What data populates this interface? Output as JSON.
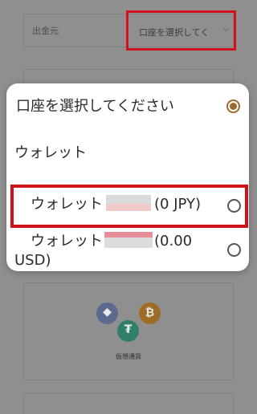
{
  "form": {
    "source_label": "出金元",
    "source_select_value": "口座を選択してく"
  },
  "crypto": {
    "label": "仮想通貨",
    "icons": [
      "ethereum-icon",
      "bitcoin-icon",
      "tether-icon"
    ],
    "glyphs": {
      "eth": "◆",
      "btc": "₿",
      "usdt": "₮"
    }
  },
  "dialog": {
    "options": [
      {
        "label": "口座を選択してください",
        "selected": true
      },
      {
        "label": "ウォレット",
        "is_header": true
      },
      {
        "prefix": "ウォレット",
        "suffix": "(0 JPY)",
        "selected": false
      },
      {
        "prefix": "ウォレット",
        "suffix": "(0.00",
        "suffix_line2": "USD)",
        "selected": false
      }
    ]
  },
  "colors": {
    "highlight": "#d0121b",
    "radio_selected": "#9a6b2a",
    "overlay": "#8f8f8f"
  }
}
